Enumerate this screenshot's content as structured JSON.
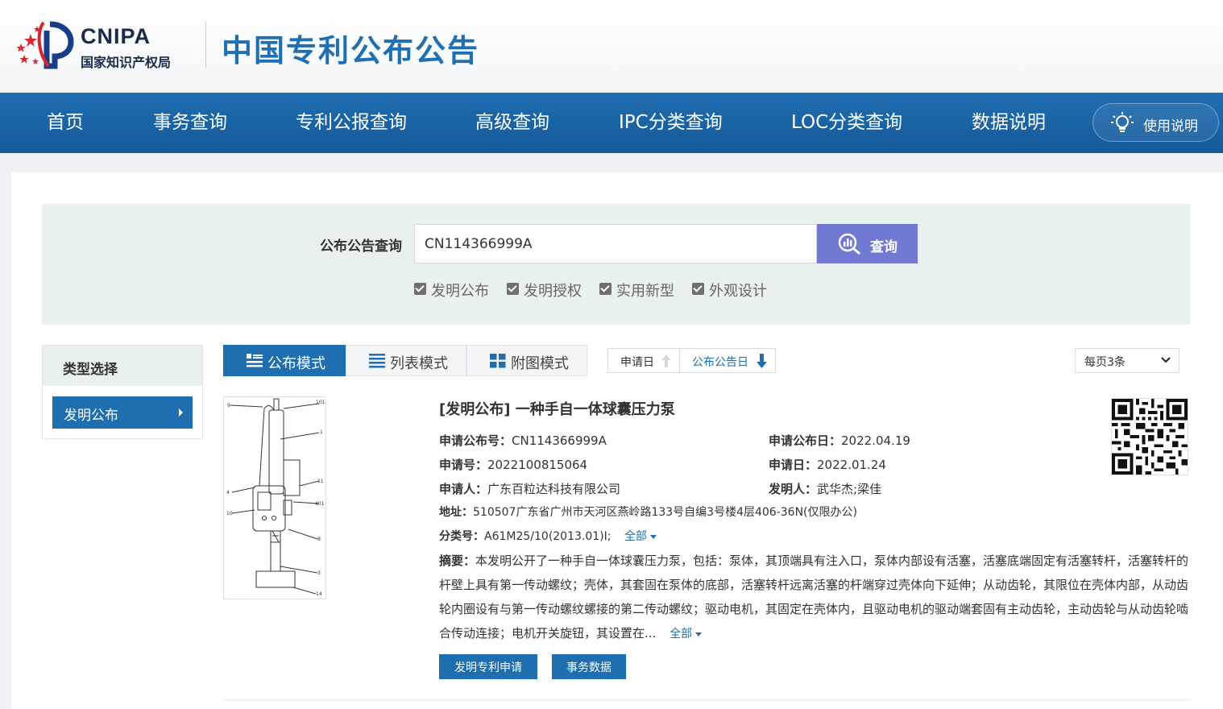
{
  "header": {
    "logo_abbr": "CNIPA",
    "logo_cn": "国家知识产权局",
    "site_title": "中国专利公布公告"
  },
  "nav": {
    "items": [
      "首页",
      "事务查询",
      "专利公报查询",
      "高级查询",
      "IPC分类查询",
      "LOC分类查询",
      "数据说明"
    ],
    "help_label": "使用说明"
  },
  "search": {
    "label": "公布公告查询",
    "value": "CN114366999A",
    "button_label": "查询",
    "checkboxes": [
      {
        "label": "发明公布",
        "checked": true
      },
      {
        "label": "发明授权",
        "checked": true
      },
      {
        "label": "实用新型",
        "checked": true
      },
      {
        "label": "外观设计",
        "checked": true
      }
    ]
  },
  "filter": {
    "title": "类型选择",
    "selected": "发明公布"
  },
  "toolbar": {
    "modes": [
      "公布模式",
      "列表模式",
      "附图模式"
    ],
    "active_mode": "公布模式",
    "sort": [
      "申请日",
      "公布公告日"
    ],
    "active_sort": "公布公告日",
    "per_page": "每页3条"
  },
  "result": {
    "title": "[发明公布] 一种手自一体球囊压力泵",
    "pub_no_label": "申请公布号：",
    "pub_no": "CN114366999A",
    "pub_date_label": "申请公布日：",
    "pub_date": "2022.04.19",
    "app_no_label": "申请号：",
    "app_no": "2022100815064",
    "app_date_label": "申请日：",
    "app_date": "2022.01.24",
    "applicant_label": "申请人：",
    "applicant": "广东百粒达科技有限公司",
    "inventor_label": "发明人：",
    "inventor": "武华杰;梁佳",
    "address_label": "地址：",
    "address": "510507广东省广州市天河区燕岭路133号自编3号楼4层406-36N(仅限办公)",
    "class_label": "分类号：",
    "class": "A61M25/10(2013.01)I;",
    "expand_label": "全部",
    "abstract_label": "摘要：",
    "abstract": "本发明公开了一种手自一体球囊压力泵，包括：泵体，其顶端具有注入口，泵体内部设有活塞，活塞底端固定有活塞转杆，活塞转杆的杆壁上具有第一传动螺纹；壳体，其套固在泵体的底部，活塞转杆远离活塞的杆端穿过壳体向下延伸；从动齿轮，其限位在壳体内部，从动齿轮内圈设有与第一传动螺纹螺接的第二传动螺纹；驱动电机，其固定在壳体内，且驱动电机的驱动端套固有主动齿轮，主动齿轮与从动齿轮啮合传动连接；电机开关旋钮，其设置在...",
    "buttons": [
      "发明专利申请",
      "事务数据"
    ],
    "figure_labels": [
      "9",
      "101",
      "1",
      "11",
      "401",
      "4",
      "10",
      "8",
      "3",
      "14"
    ]
  },
  "colors": {
    "brand_blue": "#1f6eb0",
    "search_button": "#7179d2",
    "panel_bg": "#e8f1f0"
  }
}
